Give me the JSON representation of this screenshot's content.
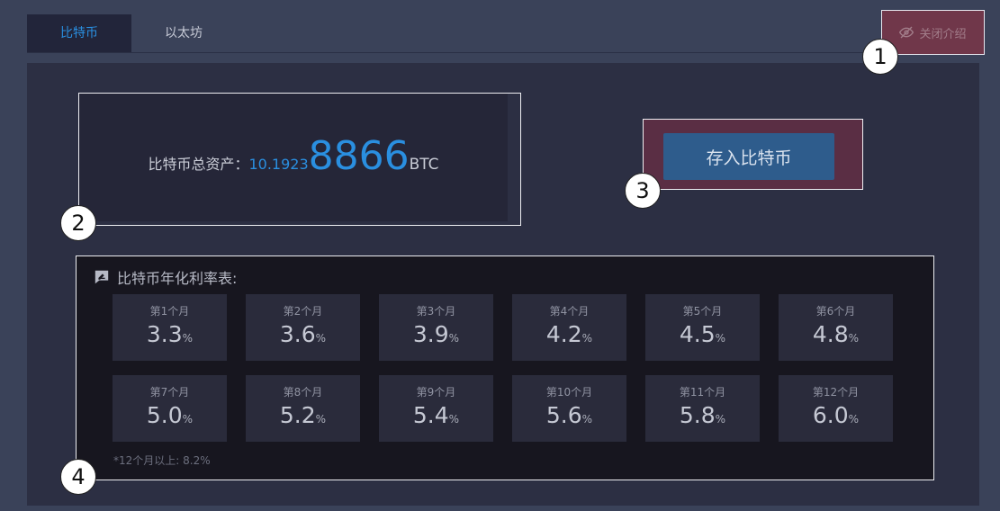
{
  "tabs": [
    {
      "label": "比特币",
      "active": true
    },
    {
      "label": "以太坊",
      "active": false
    }
  ],
  "close_intro": {
    "label": "关闭介绍",
    "icon": "eye-slash-icon"
  },
  "asset": {
    "label": "比特币总资产：",
    "value_small": "10.1923",
    "value_big": "8866",
    "unit": "BTC"
  },
  "deposit": {
    "label": "存入比特币"
  },
  "rates": {
    "title": "比特币年化利率表:",
    "icon": "chat-edit-icon",
    "pct_symbol": "%",
    "items": [
      {
        "month": "第1个月",
        "value": "3.3"
      },
      {
        "month": "第2个月",
        "value": "3.6"
      },
      {
        "month": "第3个月",
        "value": "3.9"
      },
      {
        "month": "第4个月",
        "value": "4.2"
      },
      {
        "month": "第5个月",
        "value": "4.5"
      },
      {
        "month": "第6个月",
        "value": "4.8"
      },
      {
        "month": "第7个月",
        "value": "5.0"
      },
      {
        "month": "第8个月",
        "value": "5.2"
      },
      {
        "month": "第9个月",
        "value": "5.4"
      },
      {
        "month": "第10个月",
        "value": "5.6"
      },
      {
        "month": "第11个月",
        "value": "5.8"
      },
      {
        "month": "第12个月",
        "value": "6.0"
      }
    ],
    "note": "*12个月以上: 8.2%"
  },
  "callouts": [
    "1",
    "2",
    "3",
    "4"
  ],
  "colors": {
    "accent": "#2a8fe0",
    "panel": "#2c2f43",
    "deposit": "#2e5c8c"
  }
}
